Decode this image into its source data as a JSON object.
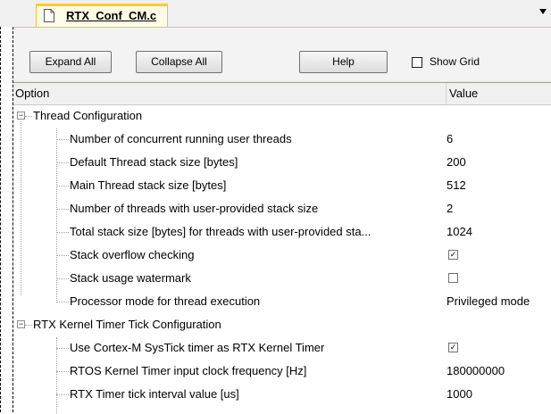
{
  "tab": {
    "title": "RTX_Conf_CM.c",
    "icon": "file-icon"
  },
  "toolbar": {
    "expand_label": "Expand All",
    "collapse_label": "Collapse All",
    "help_label": "Help",
    "show_grid_label": "Show Grid",
    "show_grid_checked": false
  },
  "columns": {
    "option": "Option",
    "value": "Value"
  },
  "tree": {
    "thread_config": {
      "label": "Thread Configuration",
      "expanded": true,
      "items": [
        {
          "label": "Number of concurrent running user threads",
          "value": "6"
        },
        {
          "label": "Default Thread stack size [bytes]",
          "value": "200"
        },
        {
          "label": "Main Thread stack size [bytes]",
          "value": "512"
        },
        {
          "label": "Number of threads with user-provided stack size",
          "value": "2"
        },
        {
          "label": "Total stack size [bytes] for threads with user-provided sta...",
          "value": "1024"
        },
        {
          "label": "Stack overflow checking",
          "checked": true
        },
        {
          "label": "Stack usage watermark",
          "checked": false
        },
        {
          "label": "Processor mode for thread execution",
          "value": "Privileged mode"
        }
      ]
    },
    "timer_config": {
      "label": "RTX Kernel Timer Tick Configuration",
      "expanded": true,
      "items": [
        {
          "label": "Use Cortex-M SysTick timer as RTX Kernel Timer",
          "checked": true
        },
        {
          "label": "RTOS Kernel Timer input clock frequency [Hz]",
          "value": "180000000"
        },
        {
          "label": "RTX Timer tick interval value [us]",
          "value": "1000"
        }
      ]
    }
  }
}
